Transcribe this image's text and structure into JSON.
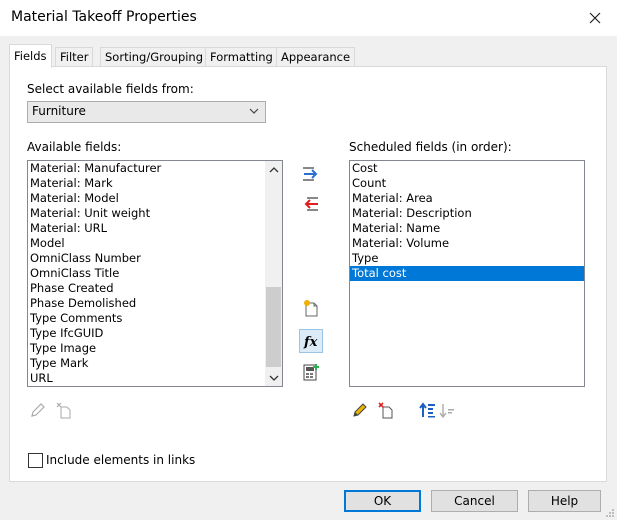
{
  "window": {
    "title": "Material Takeoff Properties"
  },
  "tabs": [
    {
      "label": "Fields",
      "active": true
    },
    {
      "label": "Filter",
      "active": false
    },
    {
      "label": "Sorting/Grouping",
      "active": false
    },
    {
      "label": "Formatting",
      "active": false
    },
    {
      "label": "Appearance",
      "active": false
    }
  ],
  "fields_tab": {
    "select_label": "Select available fields from:",
    "select_value": "Furniture",
    "available_label": "Available fields:",
    "available_fields": [
      "Material: Manufacturer",
      "Material: Mark",
      "Material: Model",
      "Material: Unit weight",
      "Material: URL",
      "Model",
      "OmniClass Number",
      "OmniClass Title",
      "Phase Created",
      "Phase Demolished",
      "Type Comments",
      "Type IfcGUID",
      "Type Image",
      "Type Mark",
      "URL"
    ],
    "scheduled_label": "Scheduled fields (in order):",
    "scheduled_fields": [
      "Cost",
      "Count",
      "Material: Area",
      "Material: Description",
      "Material: Name",
      "Material: Volume",
      "Type",
      "Total cost"
    ],
    "selected_scheduled_index": 7,
    "include_links_label": "Include elements in links",
    "include_links_checked": false
  },
  "buttons": {
    "ok": "OK",
    "cancel": "Cancel",
    "help": "Help"
  },
  "colors": {
    "selection": "#0078d7",
    "add_arrow": "#2a6fd6",
    "remove_arrow": "#e02020"
  }
}
